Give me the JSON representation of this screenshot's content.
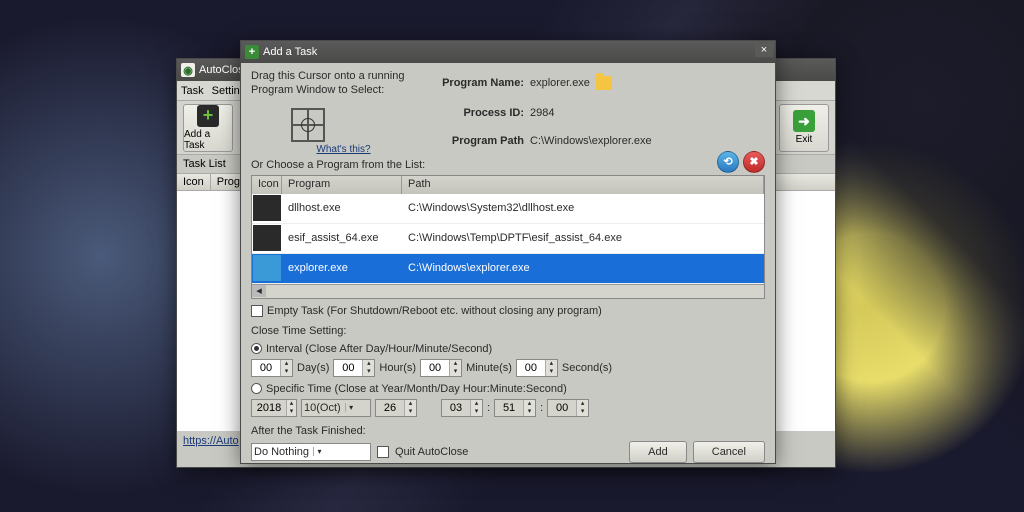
{
  "main_window": {
    "title": "AutoClose",
    "menu": [
      "Task",
      "Setting"
    ],
    "toolbar": {
      "add": "Add a Task",
      "exit": "Exit"
    },
    "tasklist_label": "Task List",
    "tasklist_cols": [
      "Icon",
      "Prog"
    ],
    "footer_link": "https://Auto"
  },
  "modal": {
    "title": "Add a Task",
    "drag_text": "Drag this Cursor onto a running Program Window to Select:",
    "whats_this": "What's this?",
    "info": {
      "name_k": "Program Name:",
      "name_v": "explorer.exe",
      "pid_k": "Process ID:",
      "pid_v": "2984",
      "path_k": "Program Path",
      "path_v": "C:\\Windows\\explorer.exe"
    },
    "list_label": "Or Choose a Program from the List:",
    "cols": {
      "icon": "Icon",
      "program": "Program",
      "path": "Path"
    },
    "rows": [
      {
        "program": "dllhost.exe",
        "path": "C:\\Windows\\System32\\dllhost.exe",
        "selected": false
      },
      {
        "program": "esif_assist_64.exe",
        "path": "C:\\Windows\\Temp\\DPTF\\esif_assist_64.exe",
        "selected": false
      },
      {
        "program": "explorer.exe",
        "path": "C:\\Windows\\explorer.exe",
        "selected": true
      }
    ],
    "empty_task": "Empty Task (For Shutdown/Reboot etc. without closing any program)",
    "close_time_label": "Close Time Setting:",
    "interval_label": "Interval (Close After Day/Hour/Minute/Second)",
    "interval": {
      "day_v": "00",
      "day_l": "Day(s)",
      "hour_v": "00",
      "hour_l": "Hour(s)",
      "min_v": "00",
      "min_l": "Minute(s)",
      "sec_v": "00",
      "sec_l": "Second(s)"
    },
    "specific_label": "Specific Time (Close at Year/Month/Day Hour:Minute:Second)",
    "specific": {
      "year": "2018",
      "month": "10(Oct)",
      "day": "26",
      "hour": "03",
      "min": "51",
      "sec": "00"
    },
    "after_label": "After the Task Finished:",
    "after_action": "Do Nothing",
    "quit_label": "Quit AutoClose",
    "add_btn": "Add",
    "cancel_btn": "Cancel"
  }
}
